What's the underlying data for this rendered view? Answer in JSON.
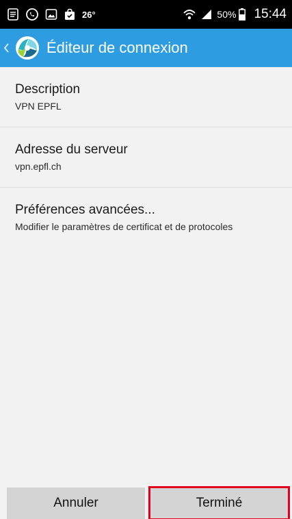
{
  "status_bar": {
    "temperature": "26°",
    "battery": "50%",
    "time": "15:44",
    "left_icons": [
      "notes-icon",
      "whatsapp-icon",
      "gallery-icon",
      "shopping-bag-icon"
    ],
    "right_icons": [
      "wifi-icon",
      "signal-icon",
      "battery-icon"
    ]
  },
  "app_bar": {
    "title": "Éditeur de connexion",
    "color": "#2e9ce0"
  },
  "fields": [
    {
      "title": "Description",
      "value": "VPN EPFL"
    },
    {
      "title": "Adresse du serveur",
      "value": "vpn.epfl.ch"
    },
    {
      "title": "Préférences avancées...",
      "value": "Modifier le paramètres de certificat et de protocoles"
    }
  ],
  "buttons": {
    "cancel": "Annuler",
    "done": "Terminé"
  },
  "highlight_color": "#e0001b"
}
